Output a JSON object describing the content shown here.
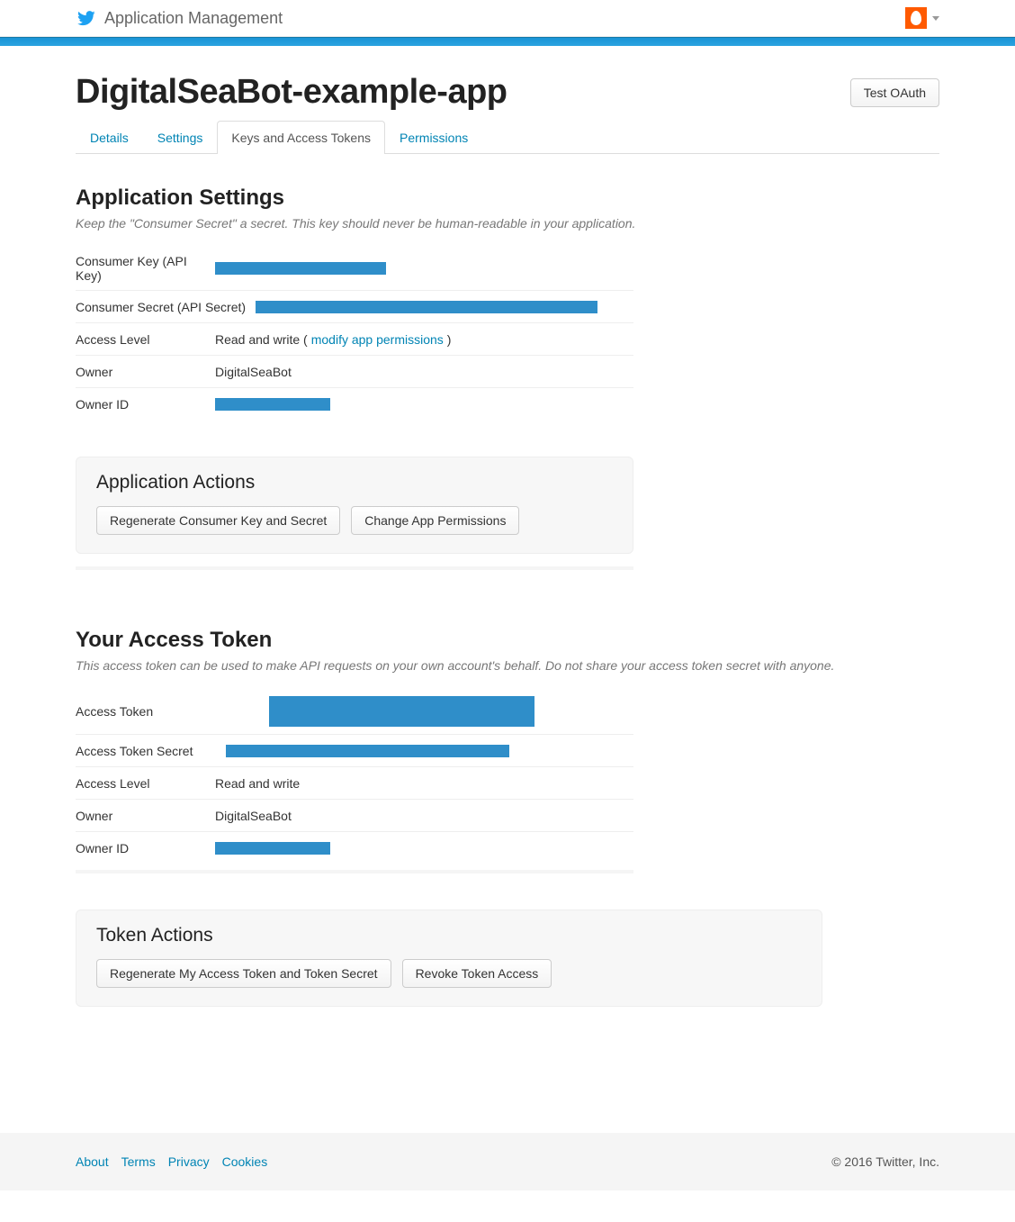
{
  "topbar": {
    "title": "Application Management"
  },
  "header": {
    "app_name": "DigitalSeaBot-example-app",
    "test_oauth_label": "Test OAuth"
  },
  "tabs": [
    {
      "label": "Details",
      "active": false
    },
    {
      "label": "Settings",
      "active": false
    },
    {
      "label": "Keys and Access Tokens",
      "active": true
    },
    {
      "label": "Permissions",
      "active": false
    }
  ],
  "app_settings": {
    "title": "Application Settings",
    "desc": "Keep the \"Consumer Secret\" a secret. This key should never be human-readable in your application.",
    "rows": {
      "consumer_key_label": "Consumer Key (API Key)",
      "consumer_secret_label": "Consumer Secret (API Secret)",
      "access_level_label": "Access Level",
      "access_level_value": "Read and write (",
      "access_level_link": "modify app permissions",
      "access_level_close": ")",
      "owner_label": "Owner",
      "owner_value": "DigitalSeaBot",
      "owner_id_label": "Owner ID"
    }
  },
  "app_actions": {
    "title": "Application Actions",
    "regenerate_label": "Regenerate Consumer Key and Secret",
    "change_perms_label": "Change App Permissions"
  },
  "access_token": {
    "title": "Your Access Token",
    "desc": "This access token can be used to make API requests on your own account's behalf. Do not share your access token secret with anyone.",
    "rows": {
      "token_label": "Access Token",
      "token_secret_label": "Access Token Secret",
      "access_level_label": "Access Level",
      "access_level_value": "Read and write",
      "owner_label": "Owner",
      "owner_value": "DigitalSeaBot",
      "owner_id_label": "Owner ID"
    }
  },
  "token_actions": {
    "title": "Token Actions",
    "regenerate_label": "Regenerate My Access Token and Token Secret",
    "revoke_label": "Revoke Token Access"
  },
  "footer": {
    "links": [
      "About",
      "Terms",
      "Privacy",
      "Cookies"
    ],
    "copyright": "© 2016 Twitter, Inc."
  }
}
